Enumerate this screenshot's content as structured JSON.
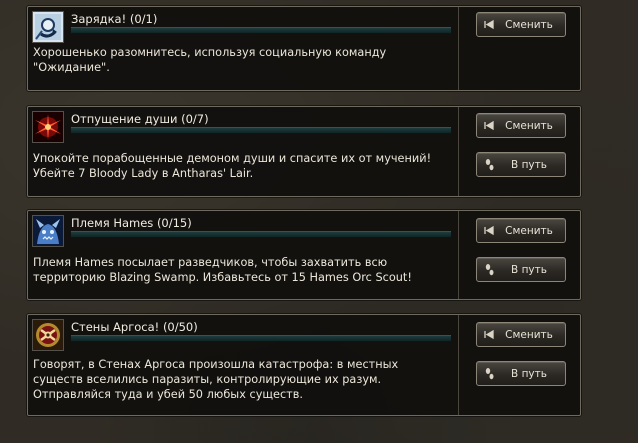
{
  "quests": [
    {
      "icon": "cycle-arrow-icon",
      "title": "Зарядка! (0/1)",
      "progress": 0,
      "description": [
        "Хорошенько разомнитесь, используя социальную команду",
        "\"Ожидание\"."
      ],
      "buttons": [
        {
          "icon": "rewind-icon",
          "label": "Сменить"
        }
      ]
    },
    {
      "icon": "soul-burst-icon",
      "title": "Отпущение души (0/7)",
      "progress": 0,
      "description": [
        "Упокойте порабощенные демоном души и спасите их от мучений!",
        "Убейте 7 Bloody Lady в Antharas' Lair."
      ],
      "buttons": [
        {
          "icon": "rewind-icon",
          "label": "Сменить"
        },
        {
          "icon": "footstep-icon",
          "label": "В путь"
        }
      ]
    },
    {
      "icon": "orc-face-icon",
      "title": "Племя Hames (0/15)",
      "progress": 0,
      "description": [
        "Племя Hames посылает разведчиков, чтобы захватить всю",
        "территорию Blazing Swamp. Избавьтесь от 15 Hames Orc Scout!"
      ],
      "buttons": [
        {
          "icon": "rewind-icon",
          "label": "Сменить"
        },
        {
          "icon": "footstep-icon",
          "label": "В путь"
        }
      ]
    },
    {
      "icon": "fortress-emblem-icon",
      "title": "Стены Аргоса! (0/50)",
      "progress": 0,
      "description": [
        "Говорят, в Стенах Аргоса произошла катастрофа: в местных",
        "существ вселились паразиты, контролирующие их разум.",
        "Отправляйся туда и убей 50 любых существ."
      ],
      "buttons": [
        {
          "icon": "rewind-icon",
          "label": "Сменить"
        },
        {
          "icon": "footstep-icon",
          "label": "В путь"
        }
      ]
    }
  ]
}
